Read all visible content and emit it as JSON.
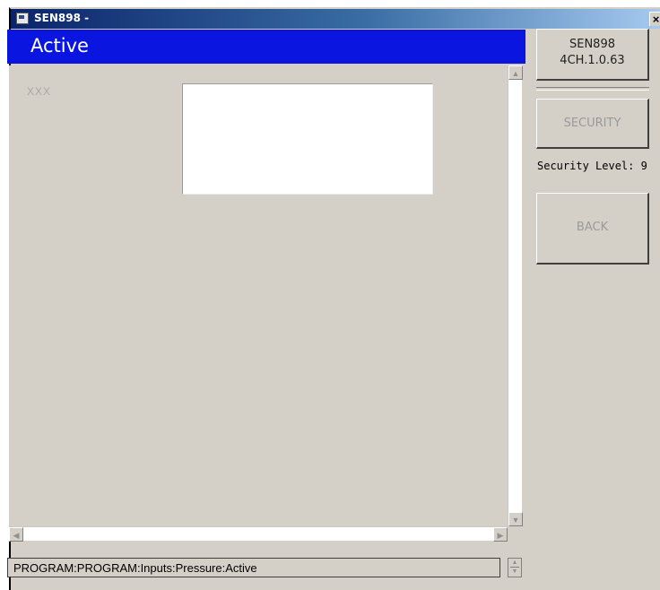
{
  "window": {
    "title": "SEN898 -",
    "close_glyph": "×"
  },
  "header": {
    "title": "Active",
    "color": "#0a16e0"
  },
  "content": {
    "placeholder": "XXX",
    "value": ""
  },
  "device": {
    "model": "SEN898",
    "version": "4CH.1.0.63"
  },
  "sidebar": {
    "security_label": "SECURITY",
    "security_level": "Security Level: 9",
    "back_label": "BACK"
  },
  "status": {
    "path": "PROGRAM:PROGRAM:Inputs:Pressure:Active"
  },
  "scroll": {
    "up": "▲",
    "down": "▼",
    "left": "◀",
    "right": "▶"
  }
}
